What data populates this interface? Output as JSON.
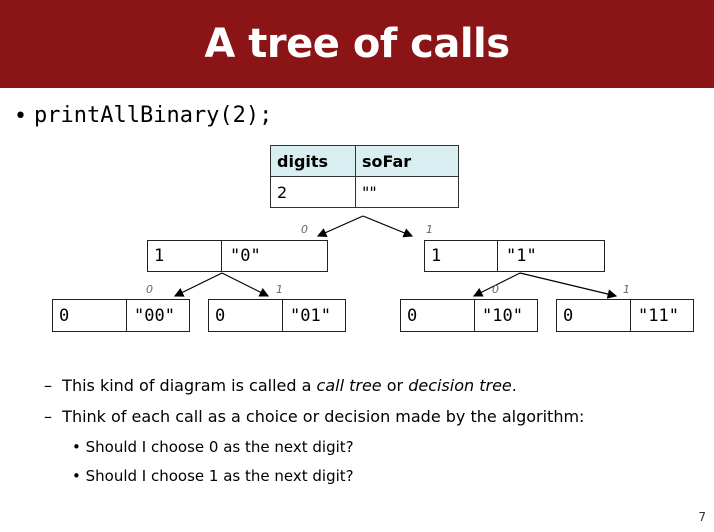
{
  "slide": {
    "title": "A tree of calls",
    "page_number": "7"
  },
  "bullet": {
    "call": "printAllBinary(2);"
  },
  "root": {
    "header_digits": "digits",
    "header_sofar": "soFar",
    "digits": "2",
    "sofar": "\"\""
  },
  "level1": [
    {
      "digits": "1",
      "sofar": "\"0\"",
      "edge_label": "0"
    },
    {
      "digits": "1",
      "sofar": "\"1\"",
      "edge_label": "1"
    }
  ],
  "level2": [
    {
      "digits": "0",
      "sofar": "\"00\"",
      "edge_label": "0"
    },
    {
      "digits": "0",
      "sofar": "\"01\"",
      "edge_label": "1"
    },
    {
      "digits": "0",
      "sofar": "\"10\"",
      "edge_label": "0"
    },
    {
      "digits": "0",
      "sofar": "\"11\"",
      "edge_label": "1"
    }
  ],
  "notes": {
    "line1_prefix": "This kind of diagram is called a ",
    "line1_term1": "call tree",
    "line1_mid": " or ",
    "line1_term2": "decision tree",
    "line1_suffix": ".",
    "line2": "Think of each call as a choice or decision made by the algorithm:",
    "sub1": "Should I choose 0 as the next digit?",
    "sub2": "Should I choose 1 as the next digit?"
  }
}
